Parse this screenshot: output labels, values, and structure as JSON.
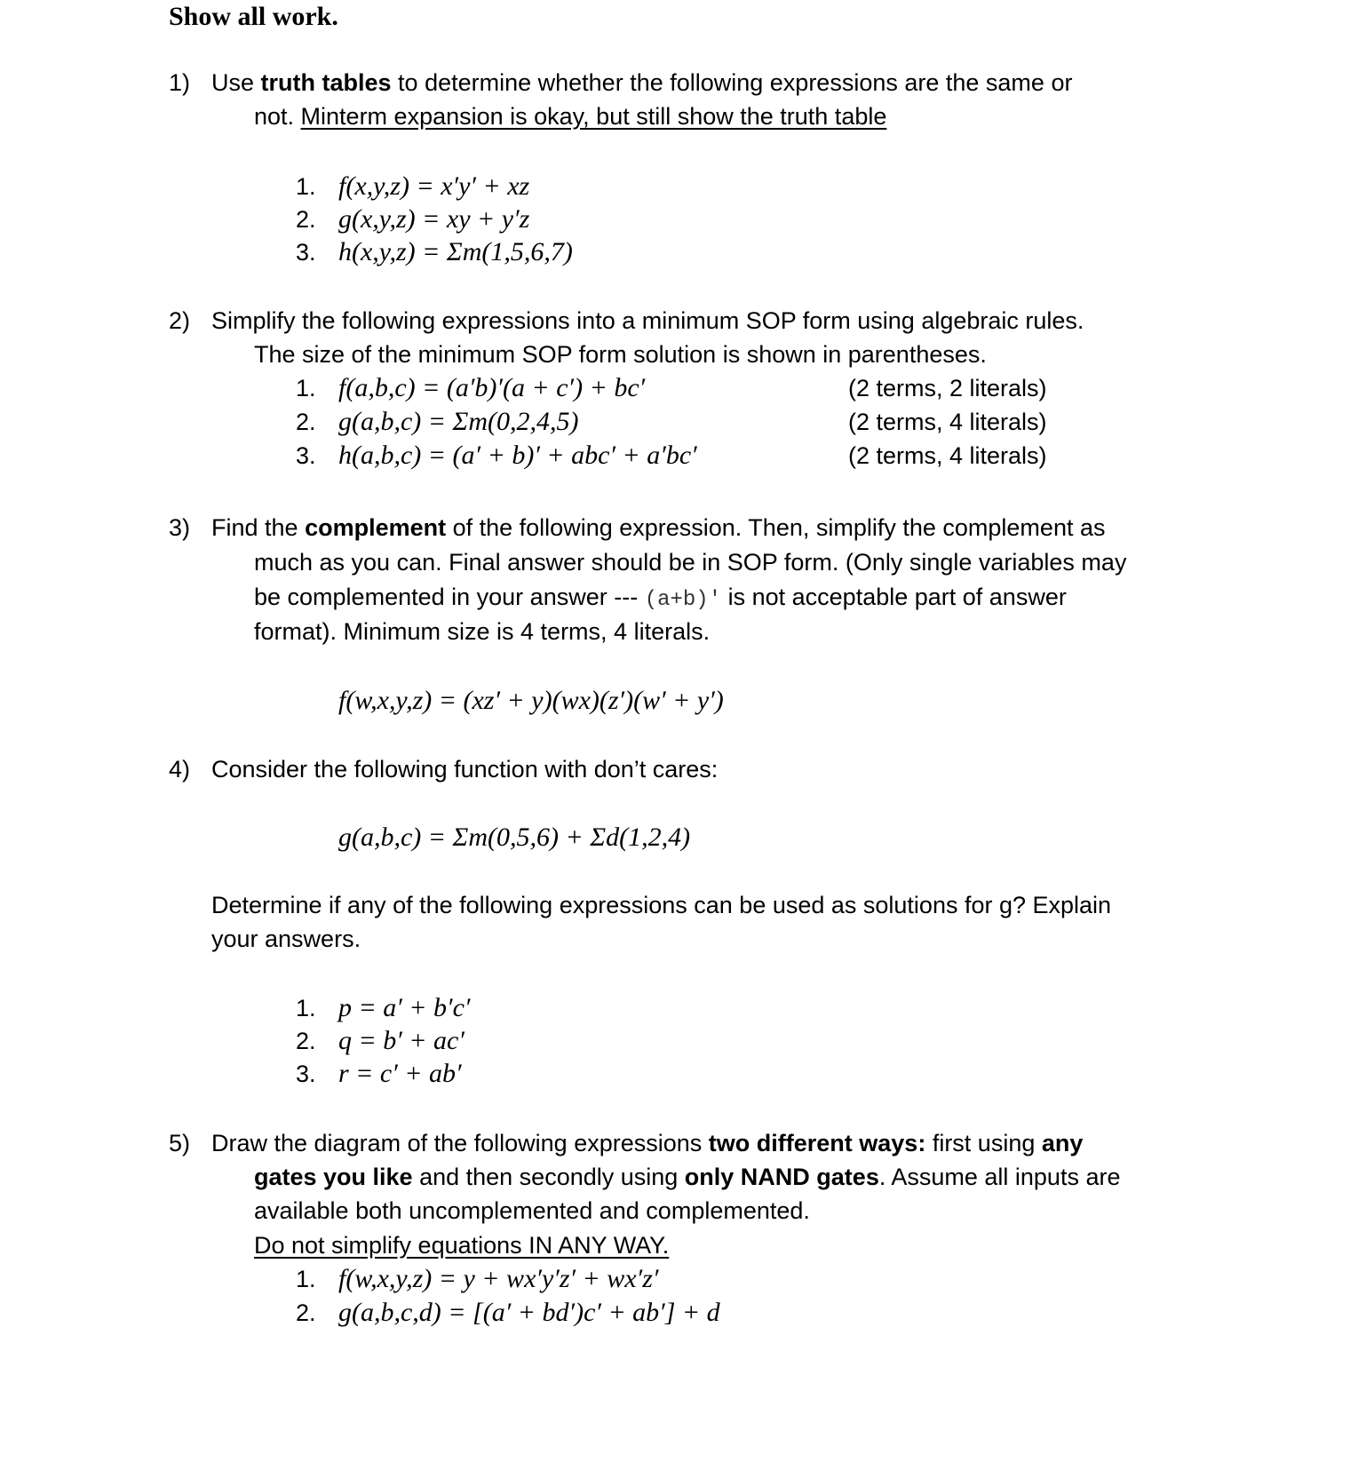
{
  "document": {
    "title": "Show all work.",
    "q1": {
      "number": "1)",
      "line1_pre": "Use ",
      "line1_bold": "truth tables",
      "line1_post": " to determine whether the following expressions are the same or",
      "line2_pre": "not. ",
      "line2_underlined": "Minterm expansion is okay, but still show the truth table",
      "items": [
        {
          "n": "1.",
          "expr": "f(x,y,z) =  x′y′ + xz"
        },
        {
          "n": "2.",
          "expr": "g(x,y,z) =  xy + y′z"
        },
        {
          "n": "3.",
          "expr": "h(x,y,z)  =  Σm(1,5,6,7)"
        }
      ]
    },
    "q2": {
      "number": "2)",
      "line1": "Simplify the following expressions into a minimum SOP form using algebraic rules.",
      "line2": "The size of the minimum SOP form solution is shown in parentheses.",
      "items": [
        {
          "n": "1.",
          "expr": "f(a,b,c) =  (a′b)′(a + c′) + bc′",
          "size": "(2 terms, 2 literals)"
        },
        {
          "n": "2.",
          "expr": "g(a,b,c)  =  Σm(0,2,4,5)",
          "size": "(2 terms, 4 literals)"
        },
        {
          "n": "3.",
          "expr": "h(a,b,c) = (a′ + b)′ + abc′ + a′bc′",
          "size": "(2 terms, 4 literals)"
        }
      ]
    },
    "q3": {
      "number": "3)",
      "line1_pre": "Find the ",
      "line1_bold": "complement",
      "line1_post": " of the following expression. Then, simplify the complement as",
      "line2": "much as you can.  Final answer should be in SOP form. (Only single variables may",
      "line3_pre": "be complemented in your answer --- ",
      "line3_code": "(a+b)′",
      "line3_post": " is not acceptable part of answer",
      "line4": "format). Minimum size is 4 terms, 4 literals.",
      "expr": "f(w,x,y,z)  = (xz′ + y)(wx)(z′)(w′ + y′)"
    },
    "q4": {
      "number": "4)",
      "line1": "Consider the following function with don’t cares:",
      "expr": "g(a,b,c) = Σm(0,5,6) + Σd(1,2,4)",
      "para1": "Determine if any of the following expressions can be used as solutions for g? Explain",
      "para2": "your answers.",
      "items": [
        {
          "n": "1.",
          "expr": "p  =  a′ + b′c′"
        },
        {
          "n": "2.",
          "expr": "q  =  b′ + ac′"
        },
        {
          "n": "3.",
          "expr": "r  =  c′ + ab′"
        }
      ]
    },
    "q5": {
      "number": "5)",
      "line1_pre": "Draw the diagram of the following expressions ",
      "line1_bold": "two different ways:",
      "line1_mid": " first using ",
      "line1_bold2": "any",
      "line2_bold": "gates you like",
      "line2_mid": " and then secondly using ",
      "line2_bold2": "only NAND gates",
      "line2_post": ". Assume all inputs are",
      "line3": "available both uncomplemented and complemented.",
      "line4_underlined": "Do not simplify equations IN ANY WAY.",
      "items": [
        {
          "n": "1.",
          "expr": "f(w,x,y,z)  =  y  +  wx′y′z′  +  wx′z′"
        },
        {
          "n": "2.",
          "expr": "g(a,b,c,d) = [(a′ + bd′)c′ + ab′] + d"
        }
      ]
    }
  }
}
